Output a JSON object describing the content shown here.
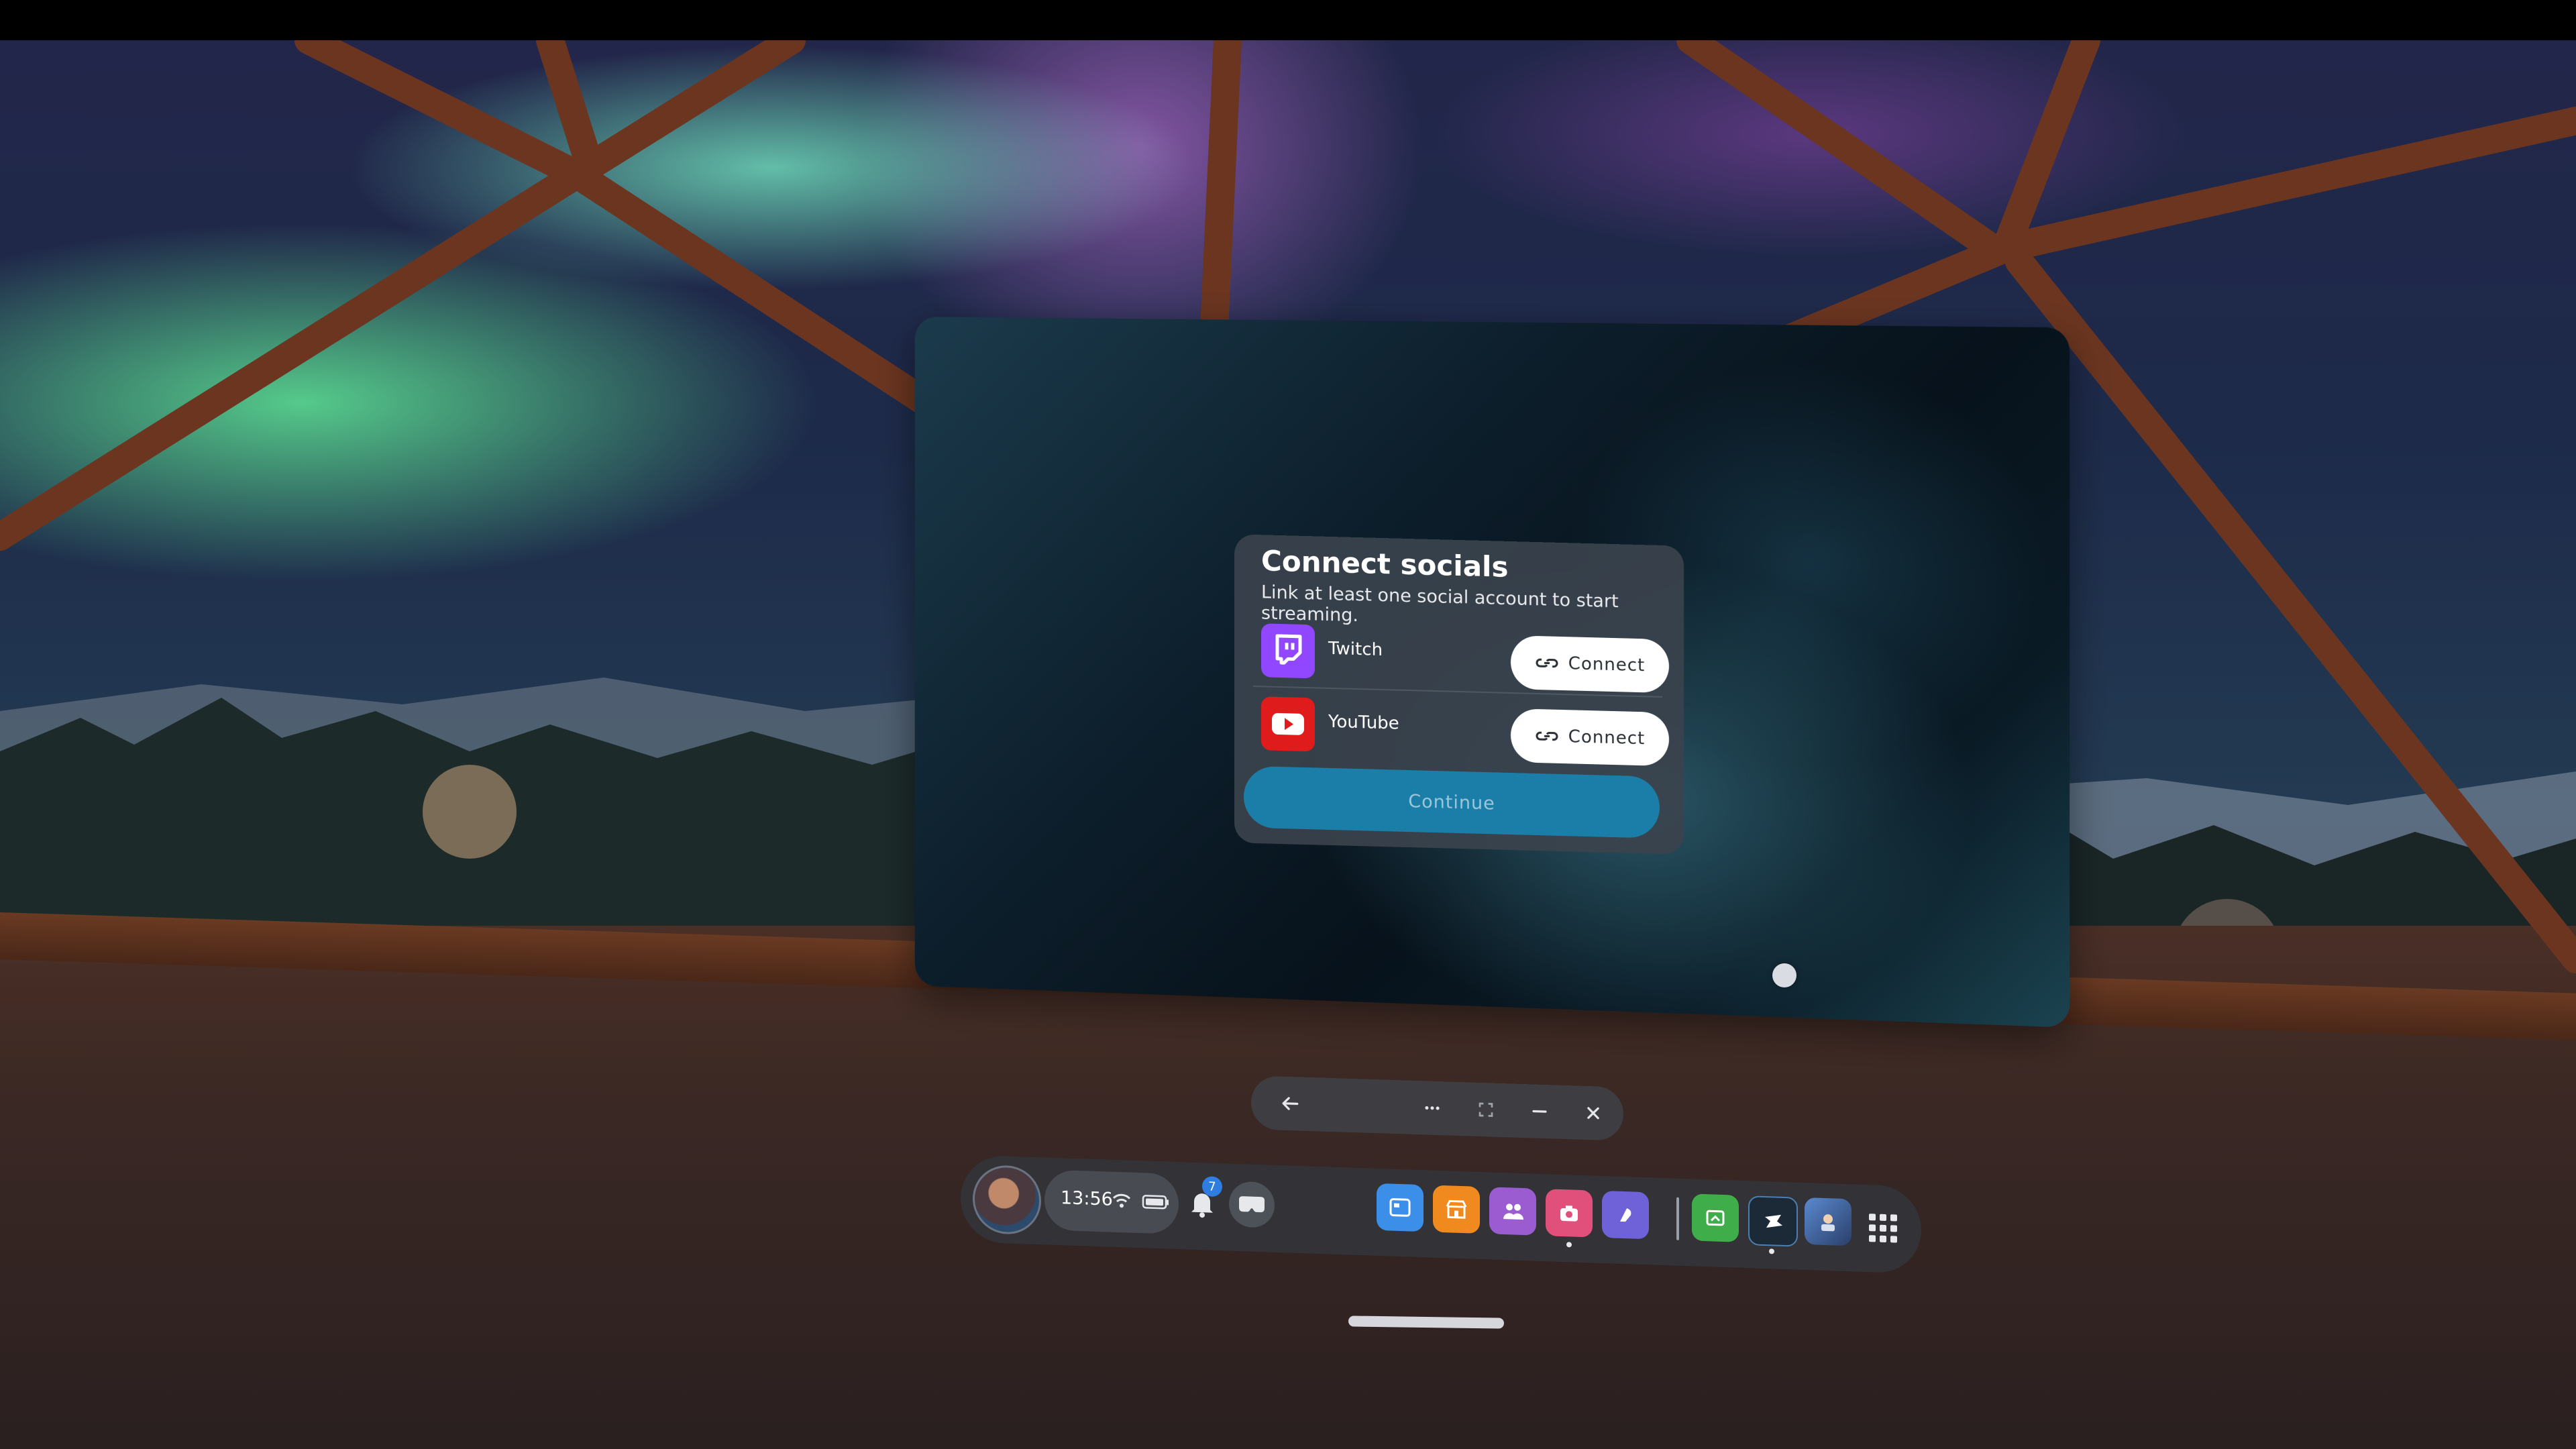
{
  "dialog": {
    "title": "Connect socials",
    "subtitle": "Link at least one social account to start streaming.",
    "socials": [
      {
        "name": "Twitch",
        "icon": "twitch-icon",
        "brand_color": "#9146ff",
        "button_label": "Connect"
      },
      {
        "name": "YouTube",
        "icon": "youtube-icon",
        "brand_color": "#ff0000",
        "button_label": "Connect"
      }
    ],
    "continue_label": "Continue"
  },
  "window_controls": {
    "icons": [
      "back-arrow-icon",
      "more-options-icon",
      "fullscreen-icon",
      "minimize-icon",
      "close-icon"
    ]
  },
  "taskbar": {
    "time": "13:56",
    "notification_count": "7",
    "status_icons": [
      "wifi-icon",
      "battery-icon"
    ],
    "apps": [
      {
        "name": "browser-app",
        "color": "#3b8fe8"
      },
      {
        "name": "store-app",
        "color": "#f08a1e"
      },
      {
        "name": "people-app",
        "color": "#9a5cd0"
      },
      {
        "name": "camera-app",
        "color": "#e0507a"
      },
      {
        "name": "horizon-app",
        "color": "#6f62d8"
      },
      {
        "name": "files-app",
        "color": "#3fae4a"
      },
      {
        "name": "streaming-app",
        "color": "#1c2a38"
      },
      {
        "name": "game-app",
        "color": "#3a5a8a"
      }
    ]
  },
  "colors": {
    "accent": "#1a7ea8",
    "dialog_bg": "#3a424c"
  }
}
